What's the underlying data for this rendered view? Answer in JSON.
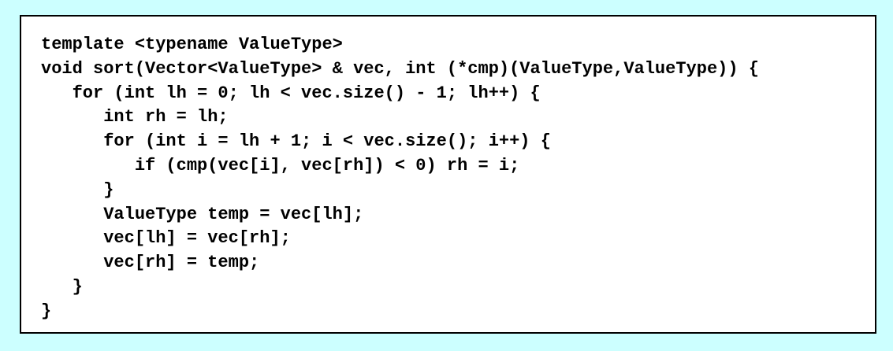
{
  "code": {
    "lines": [
      "template <typename ValueType>",
      "void sort(Vector<ValueType> & vec, int (*cmp)(ValueType,ValueType)) {",
      "   for (int lh = 0; lh < vec.size() - 1; lh++) {",
      "      int rh = lh;",
      "      for (int i = lh + 1; i < vec.size(); i++) {",
      "         if (cmp(vec[i], vec[rh]) < 0) rh = i;",
      "      }",
      "      ValueType temp = vec[lh];",
      "      vec[lh] = vec[rh];",
      "      vec[rh] = temp;",
      "   }",
      "}"
    ]
  },
  "colors": {
    "background": "#ccffff",
    "code_box": "#ffffff",
    "border": "#000000",
    "text": "#000000"
  }
}
